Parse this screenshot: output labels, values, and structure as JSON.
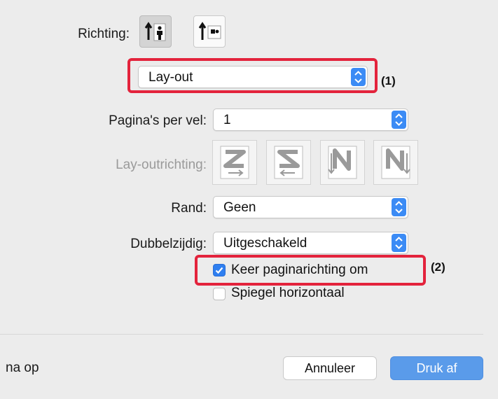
{
  "orientation": {
    "label": "Richting:",
    "options": [
      "portrait-person-icon",
      "landscape-person-icon"
    ]
  },
  "section_popup": {
    "value": "Lay-out",
    "callout": "(1)"
  },
  "layout": {
    "pages_per_sheet_label": "Pagina's per vel:",
    "pages_per_sheet_value": "1",
    "direction_label": "Lay-outrichting:",
    "direction_icons": [
      "z-direction-icon",
      "s-direction-icon",
      "reverse-n-direction-icon",
      "n-direction-icon"
    ],
    "border_label": "Rand:",
    "border_value": "Geen",
    "duplex_label": "Dubbelzijdig:",
    "duplex_value": "Uitgeschakeld",
    "reverse_page_orientation": {
      "label": "Keer paginarichting om",
      "checked": true,
      "callout": "(2)"
    },
    "flip_horizontal": {
      "label": "Spiegel horizontaal",
      "checked": false
    }
  },
  "footer": {
    "left_text": "na op",
    "cancel_label": "Annuleer",
    "print_label": "Druk af"
  },
  "colors": {
    "accent": "#3b8bf5",
    "highlight": "#e3233c",
    "primary_button": "#5a9bea"
  }
}
